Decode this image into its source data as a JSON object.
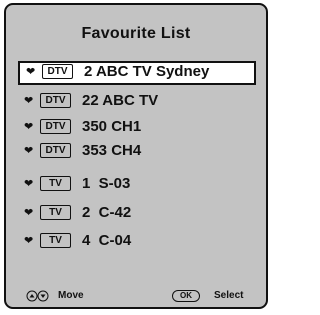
{
  "title": "Favourite List",
  "items": [
    {
      "tag": "DTV",
      "label": "2 ABC TV Sydney",
      "selected": true
    },
    {
      "tag": "DTV",
      "label": "22 ABC TV",
      "selected": false
    },
    {
      "tag": "DTV",
      "label": "350 CH1",
      "selected": false
    },
    {
      "tag": "DTV",
      "label": "353 CH4",
      "selected": false
    },
    {
      "tag": "TV",
      "label": "1  S-03",
      "selected": false
    },
    {
      "tag": "TV",
      "label": "2  C-42",
      "selected": false
    },
    {
      "tag": "TV",
      "label": "4  C-04",
      "selected": false
    }
  ],
  "footer": {
    "move_label": "Move",
    "ok_label": "OK",
    "select_label": "Select"
  },
  "icons": {
    "favourite": "heart-icon",
    "navigate": "up-down-arrows-icon"
  },
  "colors": {
    "panel": "#c3c3c3",
    "highlight": "#ffffff",
    "text": "#111111"
  }
}
